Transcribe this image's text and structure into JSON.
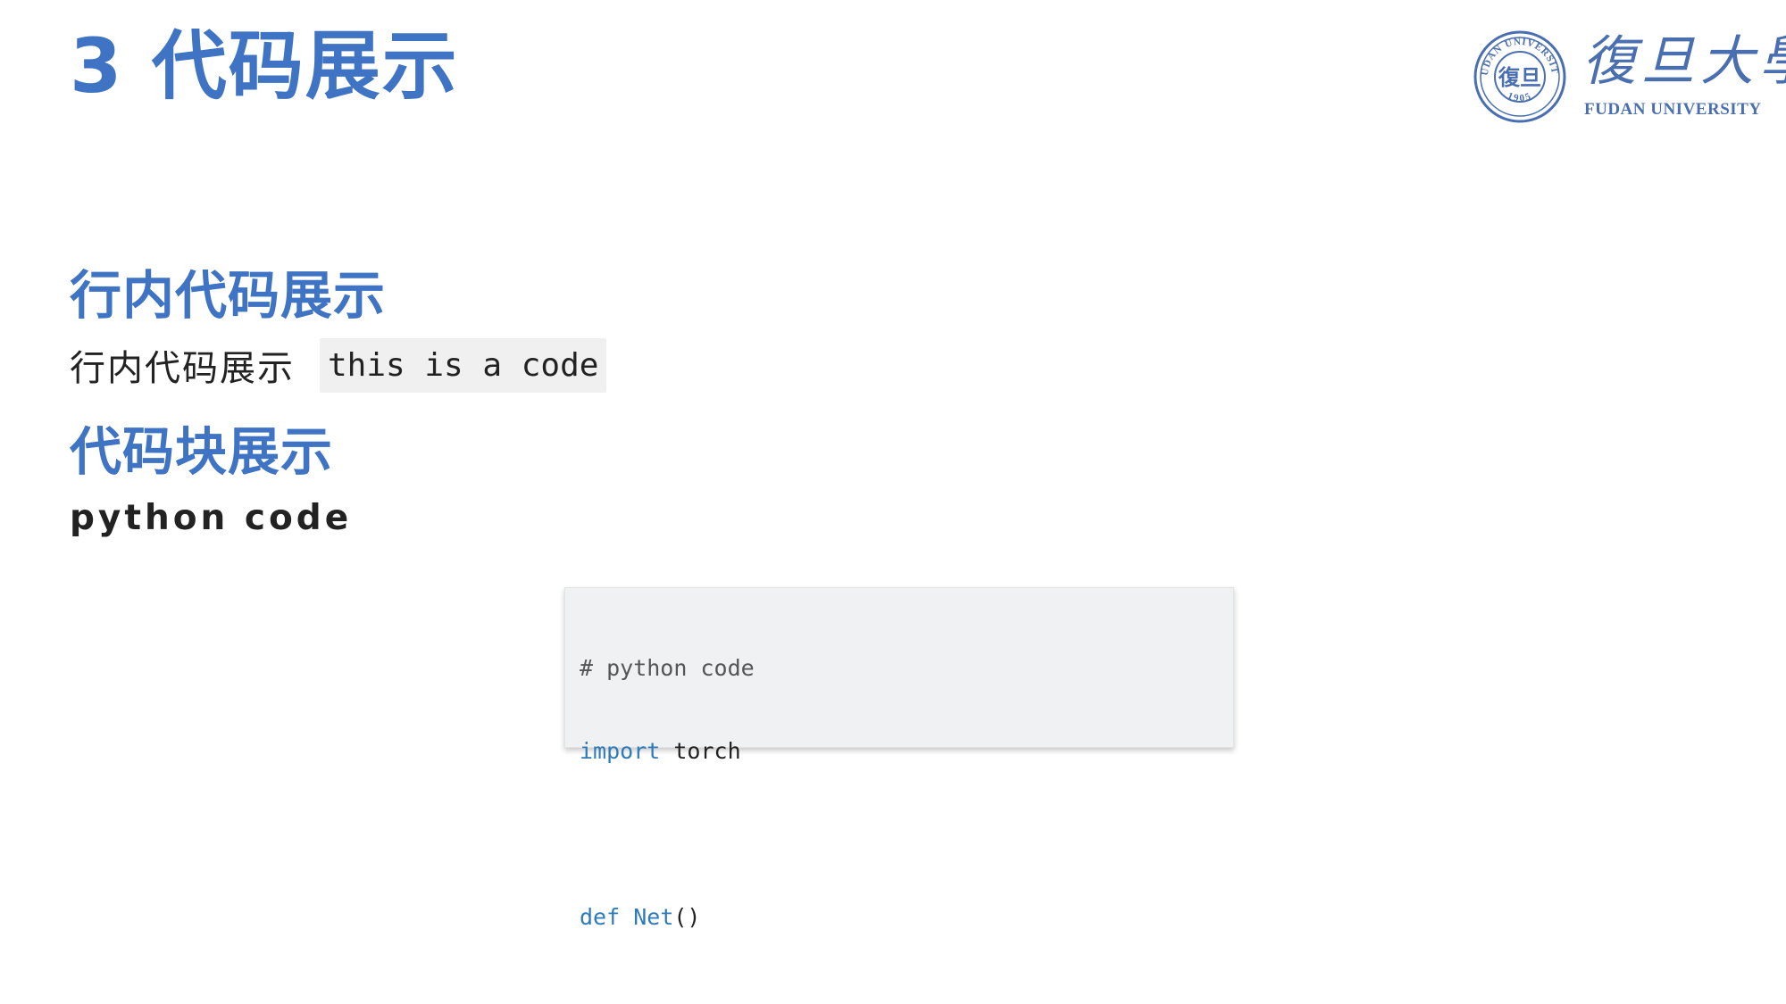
{
  "slide": {
    "title": "3 代码展示"
  },
  "logo": {
    "seal_text_top": "FUDAN UNIVERSITY",
    "seal_center": "復旦",
    "seal_year": "1905",
    "script_text": "復旦大學",
    "english_name": "FUDAN UNIVERSITY"
  },
  "sections": {
    "inline": {
      "heading": "行内代码展示",
      "text": "行内代码展示",
      "code": "this is a code"
    },
    "block": {
      "heading": "代码块展示",
      "label": "python code"
    }
  },
  "code_block": {
    "language": "python",
    "line1_comment": "# python code",
    "line2_keyword": "import",
    "line2_rest": " torch",
    "line4_keyword": "def",
    "line4_space": " ",
    "line4_fn": "Net",
    "line4_rest": "()"
  },
  "colors": {
    "accent": "#3f73c4",
    "logo": "#4a6fb0",
    "code_keyword": "#2f7ab8",
    "code_bg": "#f0f1f3"
  }
}
